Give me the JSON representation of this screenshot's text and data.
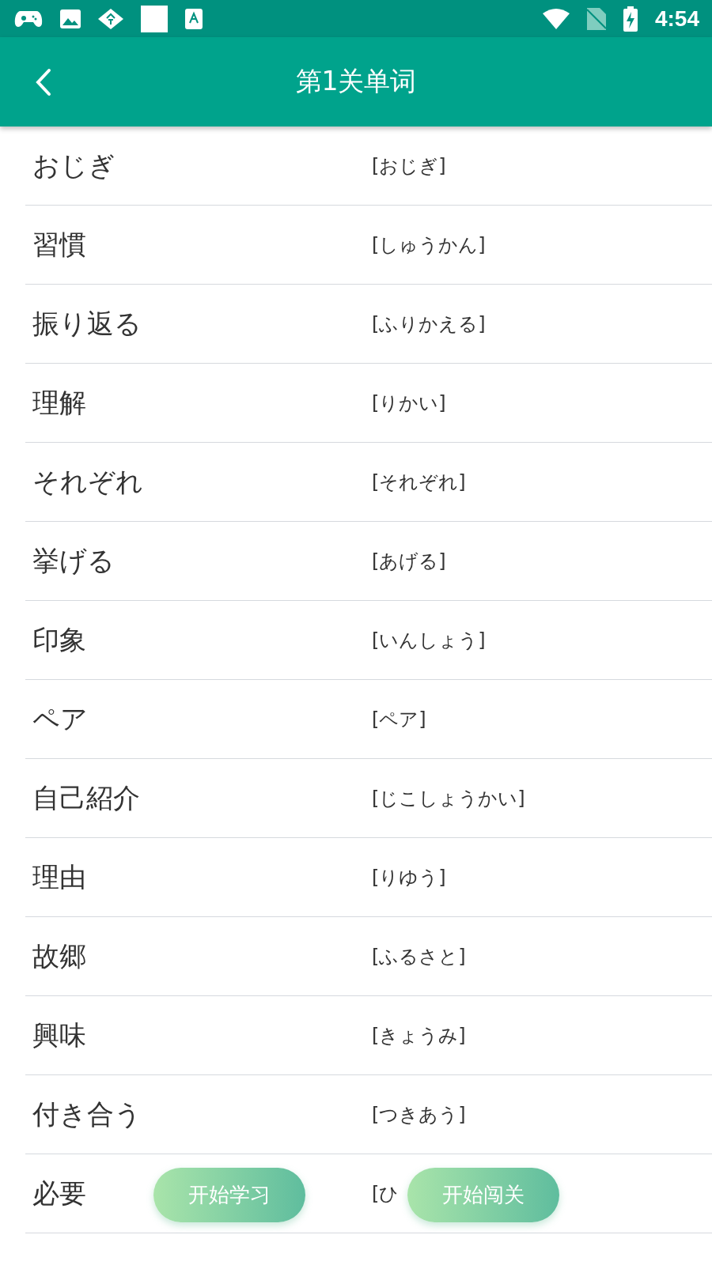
{
  "status_bar": {
    "time": "4:54"
  },
  "app_bar": {
    "title": "第1关单词"
  },
  "words": [
    {
      "word": "おじぎ",
      "reading": "[おじぎ]"
    },
    {
      "word": "習慣",
      "reading": "[しゅうかん]"
    },
    {
      "word": "振り返る",
      "reading": "[ふりかえる]"
    },
    {
      "word": "理解",
      "reading": "[りかい]"
    },
    {
      "word": "それぞれ",
      "reading": "[それぞれ]"
    },
    {
      "word": "挙げる",
      "reading": "[あげる]"
    },
    {
      "word": "印象",
      "reading": "[いんしょう]"
    },
    {
      "word": "ペア",
      "reading": "[ペア]"
    },
    {
      "word": "自己紹介",
      "reading": "[じこしょうかい]"
    },
    {
      "word": "理由",
      "reading": "[りゆう]"
    },
    {
      "word": "故郷",
      "reading": "[ふるさと]"
    },
    {
      "word": "興味",
      "reading": "[きょうみ]"
    },
    {
      "word": "付き合う",
      "reading": "[つきあう]"
    },
    {
      "word": "必要",
      "reading": "[ひ"
    }
  ],
  "buttons": [
    {
      "label": "开始学习"
    },
    {
      "label": "开始闯关"
    }
  ]
}
